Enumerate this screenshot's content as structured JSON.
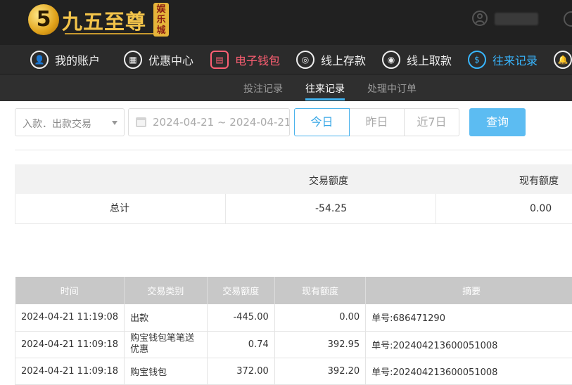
{
  "brand": {
    "logo_glyph": "5",
    "name": "九五至尊",
    "badge": "娱乐城"
  },
  "nav": {
    "items": [
      {
        "label": "我的账户",
        "icon": "user-icon"
      },
      {
        "label": "优惠中心",
        "icon": "gift-icon"
      },
      {
        "label": "电子钱包",
        "icon": "wallet-icon"
      },
      {
        "label": "线上存款",
        "icon": "deposit-icon"
      },
      {
        "label": "线上取款",
        "icon": "withdraw-icon"
      },
      {
        "label": "往来记录",
        "icon": "records-icon"
      }
    ]
  },
  "subnav": {
    "tabs": [
      {
        "label": "投注记录"
      },
      {
        "label": "往来记录"
      },
      {
        "label": "处理中订单"
      }
    ]
  },
  "filters": {
    "type_select": "入款．出款交易",
    "date_range": "2024-04-21 ~ 2024-04-21",
    "day_buttons": [
      "今日",
      "昨日",
      "近7日"
    ],
    "search_label": "查询"
  },
  "summary": {
    "headers": {
      "amount": "交易额度",
      "balance": "现有额度"
    },
    "row": {
      "label": "总计",
      "amount": "-54.25",
      "balance": "0.00"
    }
  },
  "records": {
    "headers": [
      "时间",
      "交易类别",
      "交易额度",
      "现有额度",
      "摘要"
    ],
    "rows": [
      [
        "2024-04-21 11:19:08",
        "出款",
        "-445.00",
        "0.00",
        "单号:686471290"
      ],
      [
        "2024-04-21 11:09:18",
        "购宝钱包笔笔送优惠",
        "0.74",
        "392.95",
        "单号:202404213600051008"
      ],
      [
        "2024-04-21 11:09:18",
        "购宝钱包",
        "372.00",
        "392.20",
        "单号:202404213600051008"
      ]
    ]
  },
  "colors": {
    "header_bg": "#212121",
    "accent_blue": "#38b6ff",
    "accent_red": "#ff5f73",
    "search_button": "#5cbcf2"
  }
}
